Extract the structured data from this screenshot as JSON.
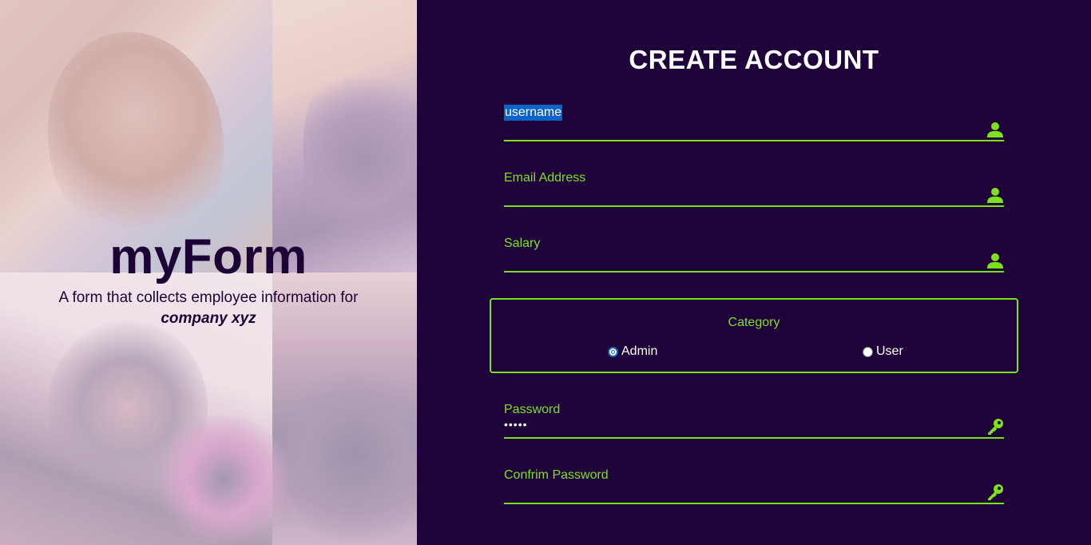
{
  "hero": {
    "brand": "myForm",
    "tagline": "A form that collects employee information for",
    "company": "company xyz"
  },
  "form": {
    "title": "CREATE ACCOUNT",
    "fields": [
      {
        "label": "username",
        "value": "",
        "icon": "user-icon"
      },
      {
        "label": "Email Address",
        "value": "",
        "icon": "user-icon"
      },
      {
        "label": "Salary",
        "value": "",
        "icon": "user-icon"
      }
    ],
    "category": {
      "label": "Category",
      "options": [
        {
          "label": "Admin",
          "checked": true
        },
        {
          "label": "User",
          "checked": false
        }
      ]
    },
    "password": {
      "label": "Password",
      "value": "•••••",
      "icon": "key-icon"
    },
    "confirm_password": {
      "label": "Confrim Password",
      "value": "",
      "icon": "key-icon"
    }
  },
  "colors": {
    "background": "#1f0239",
    "accent": "#7de21b",
    "selection": "#0b63c9",
    "title": "#ffffff"
  }
}
